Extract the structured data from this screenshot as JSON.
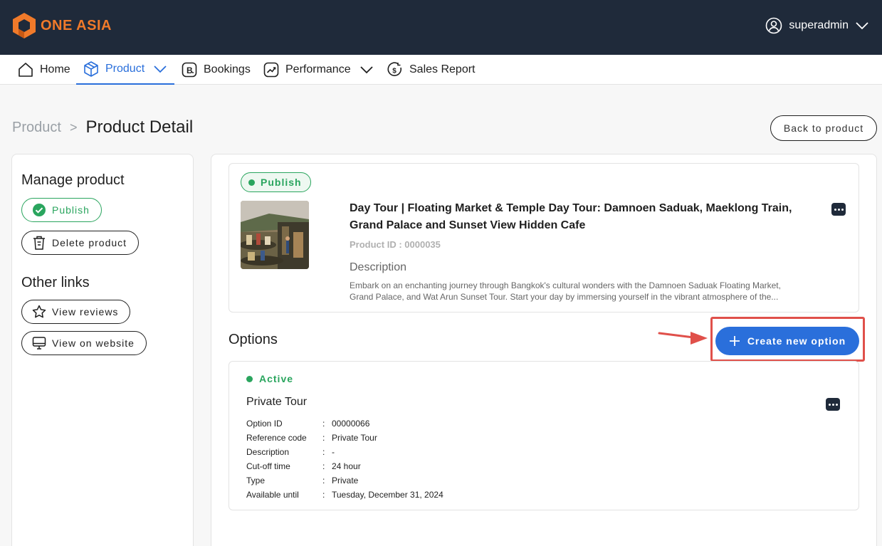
{
  "header": {
    "logo_text": "ONE ASIA",
    "user_name": "superadmin"
  },
  "nav": {
    "home": "Home",
    "product": "Product",
    "bookings": "Bookings",
    "performance": "Performance",
    "sales_report": "Sales Report"
  },
  "breadcrumb": {
    "parent": "Product",
    "separator": ">",
    "current": "Product Detail"
  },
  "back_button": "Back to product",
  "sidebar": {
    "manage_heading": "Manage product",
    "publish_label": "Publish",
    "delete_label": "Delete product",
    "other_heading": "Other links",
    "view_reviews": "View reviews",
    "view_website": "View on website"
  },
  "product": {
    "status": "Publish",
    "title": "Day Tour | Floating Market & Temple Day Tour: Damnoen Saduak, Maeklong Train, Grand Palace and Sunset View Hidden Cafe",
    "id_text": "Product ID : 0000035",
    "description_label": "Description",
    "description": "Embark on an enchanting journey through Bangkok's cultural wonders with the Damnoen Saduak Floating Market, Grand Palace, and Wat Arun Sunset Tour. Start your day by immersing yourself in the vibrant atmosphere of the..."
  },
  "options": {
    "heading": "Options",
    "create_label": "Create new option",
    "items": [
      {
        "status": "Active",
        "title": "Private Tour",
        "fields": [
          {
            "key": "Option ID",
            "value": "00000066"
          },
          {
            "key": "Reference code",
            "value": "Private Tour"
          },
          {
            "key": "Description",
            "value": "-"
          },
          {
            "key": "Cut-off time",
            "value": "24 hour"
          },
          {
            "key": "Type",
            "value": "Private"
          },
          {
            "key": "Available until",
            "value": "Tuesday, December 31, 2024"
          }
        ]
      }
    ]
  },
  "colors": {
    "header_bg": "#1f2a3a",
    "accent_blue": "#2a6fdb",
    "success_green": "#2aa55e",
    "highlight_red": "#e0504a",
    "logo_orange": "#f07a2a"
  }
}
